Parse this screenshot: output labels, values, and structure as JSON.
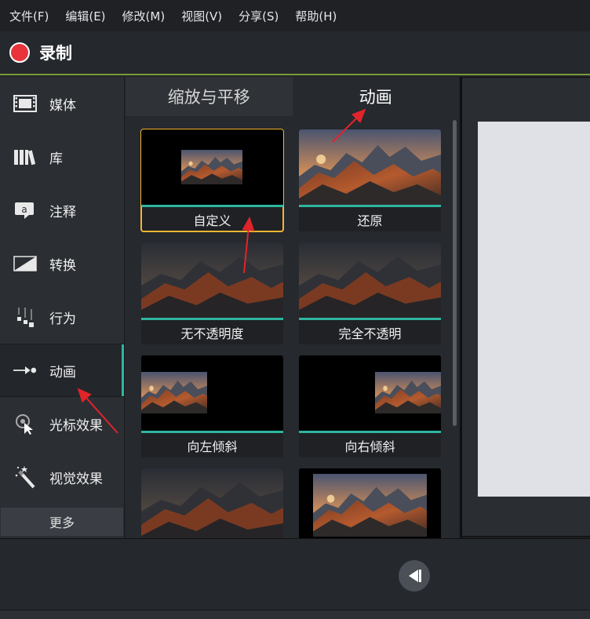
{
  "menu": [
    {
      "id": "file",
      "label": "文件(F)"
    },
    {
      "id": "edit",
      "label": "编辑(E)"
    },
    {
      "id": "modify",
      "label": "修改(M)"
    },
    {
      "id": "view",
      "label": "视图(V)"
    },
    {
      "id": "share",
      "label": "分享(S)"
    },
    {
      "id": "help",
      "label": "帮助(H)"
    }
  ],
  "record": {
    "label": "录制",
    "dot_color": "#e8333a"
  },
  "sidebar": {
    "items": [
      {
        "label": "媒体",
        "icon": "film-icon"
      },
      {
        "label": "库",
        "icon": "library-books-icon"
      },
      {
        "label": "注释",
        "icon": "callout-icon"
      },
      {
        "label": "转换",
        "icon": "transition-icon"
      },
      {
        "label": "行为",
        "icon": "behavior-icon"
      },
      {
        "label": "动画",
        "icon": "animation-arrow-icon",
        "active": true
      },
      {
        "label": "光标效果",
        "icon": "cursor-effect-icon"
      },
      {
        "label": "视觉效果",
        "icon": "magic-wand-icon"
      }
    ],
    "more_label": "更多"
  },
  "tabs": [
    {
      "label": "缩放与平移",
      "active": false
    },
    {
      "label": "动画",
      "active": true
    }
  ],
  "tiles": [
    {
      "label": "自定义",
      "selected": true
    },
    {
      "label": "还原"
    },
    {
      "label": "无不透明度"
    },
    {
      "label": "完全不透明"
    },
    {
      "label": "向左倾斜"
    },
    {
      "label": "向右倾斜"
    }
  ],
  "colors": {
    "accent_teal": "#2fb5a0",
    "selection_outline": "#f5b530",
    "record_red": "#e8333a",
    "annotation_arrow": "#e0242a"
  },
  "transport": {
    "icon": "step-back-icon"
  }
}
